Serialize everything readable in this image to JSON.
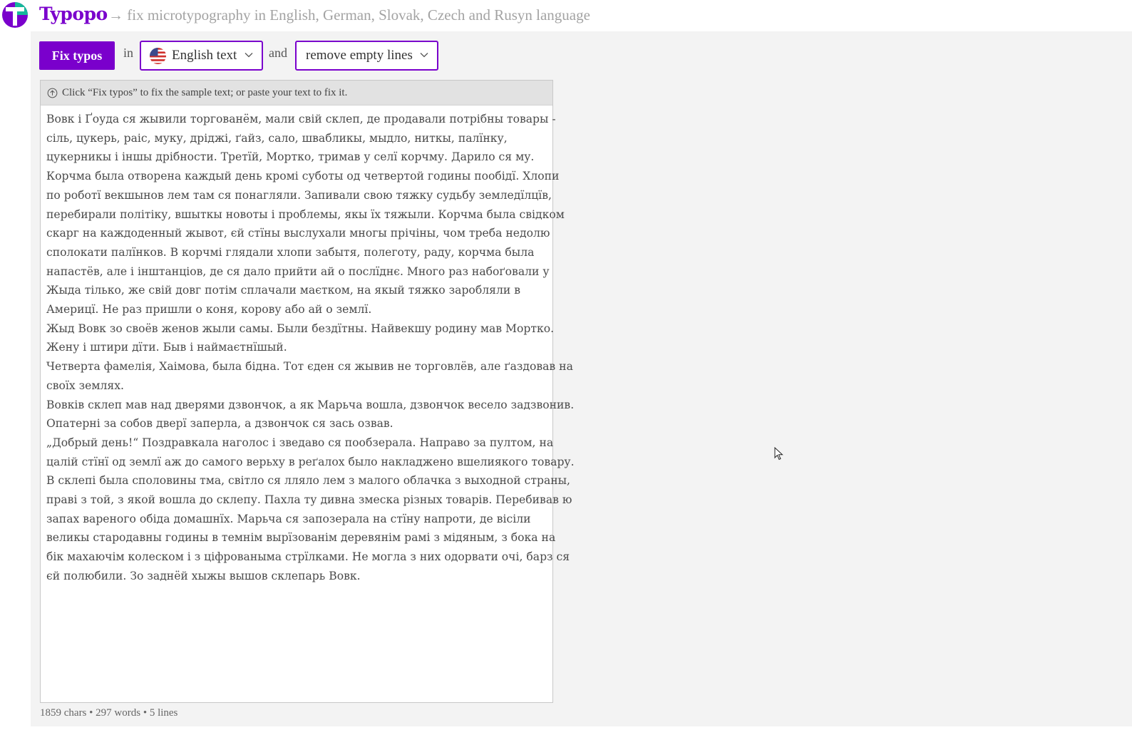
{
  "header": {
    "brand": "Typopo",
    "tagline": "→ fix microtypography in English, German, Slovak, Czech and Rusyn language"
  },
  "toolbar": {
    "fix_button": "Fix typos",
    "in_label": "in",
    "language_selected": "English text",
    "and_label": "and",
    "option_selected": "remove empty lines"
  },
  "editor": {
    "hint": "Click “Fix typos” to fix the sample text; or paste your text to fix it.",
    "lines": [
      "Вовк і Ґоуда ся жывили торгованём, мали свій склеп, де продавали потрібны товары -",
      "сіль, цукерь, раіс, муку, дріджі, ґайз, сало, швабликы, мыдло, ниткы, палїнку,",
      "цукерникы і іншы дрібности. Третїй, Мортко, тримав у селї корчму. Дарило ся му.",
      "Корчма была отворена каждый день кромі суботы од четвертой годины пообідї. Хлопи",
      "по роботї векшынов лем там ся понагляли. Запивали свою тяжку судьбу земледїлцїв,",
      "перебирали політіку, вшыткы новоты і проблемы, якы їх тяжыли. Корчма была свідком",
      "скарг на каждоденный жывот, єй стїны выслухали многы прічіны, чом треба недолю",
      "сполокати палїнков. В корчмі глядали хлопи забытя, полеготу, раду, корчма была",
      "напастёв, але і інштанціов, де ся дало прийти ай о послїднє. Много раз набоґовали у",
      "Жыда тілько, же свій довг потім сплачали маєтком, на якый тяжко заробляли в",
      "Америцї. Не раз пришли о коня, корову або ай о землї.",
      "Жыд Вовк зо своёв женов жыли самы. Были бездїтны. Найвекшу родину мав Мортко.",
      "Жену і штири дїти. Быв і наймаєтнїшый.",
      "Четверта фамелія, Хаімова, была бідна. Тот єден ся жывив не торговлёв, але ґаздовав на",
      "своїх землях.",
      "Вовків склеп мав над дверями дзвончок, а як Марьча вошла, дзвончок весело задзвонив.",
      "Опатерні за собов дверї заперла, а дзвончок ся зась озвав.",
      "„Добрый день!“ Поздравкала наголос і зведаво ся пообзерала. Направо за пултом, на",
      "цалій стїнї од землї аж до самого верьху в реґалох было накладжено вшелиякого товару.",
      "В склепі была споловины тма, світло ся лляло лем з малого облачка з выходной страны,",
      "праві з той, з якой вошла до склепу. Пахла ту дивна змеска різных товарів. Перебивав ю",
      "запах вареного обіда домашнїх. Марьча ся запозерала на стїну напроти, де вісіли",
      "великы стародавны годины в темнім вырїзованім деревянім рамі з мідяным, з бока на",
      "бік махаючім колеском і з ціфрованыма стрїлками. Не могла з них одорвати очі, барз ся",
      "єй полюбили. Зо заднёй хыжы вышов склепарь Вовк."
    ]
  },
  "stats": "1859 chars • 297 words • 5 lines"
}
